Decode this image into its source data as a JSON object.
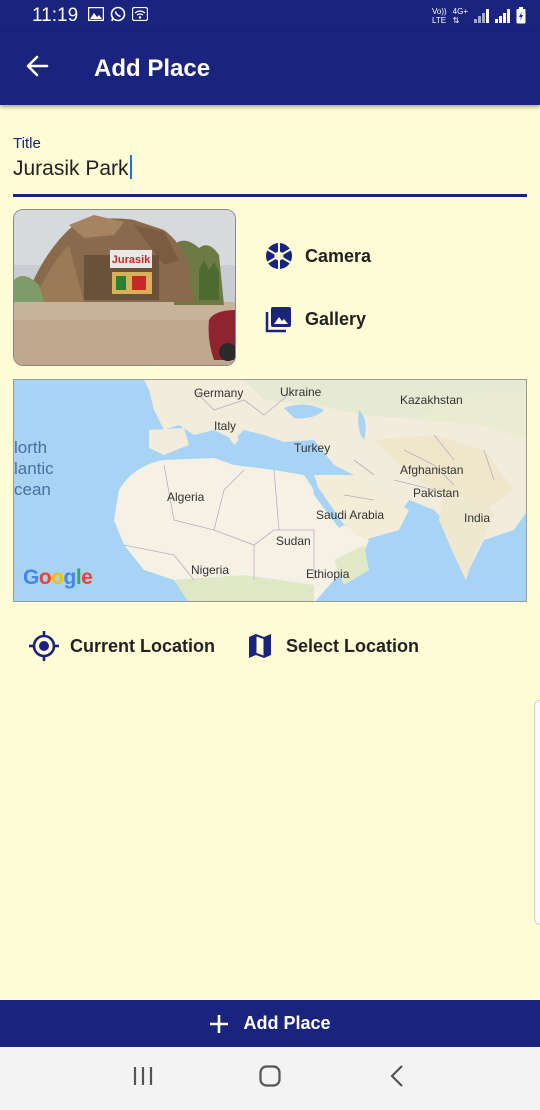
{
  "status_bar": {
    "time": "11:19",
    "volte_line1": "Vo))",
    "volte_line2": "LTE",
    "network_line1": "4G+",
    "network_line2": "⇅",
    "icons": [
      "image-icon",
      "whatsapp-icon",
      "wifi-icon",
      "signal-icon",
      "battery-icon"
    ]
  },
  "app_bar": {
    "title": "Add Place",
    "back_icon": "arrow-back-icon"
  },
  "form": {
    "title_label": "Title",
    "title_value": "Jurasik Park"
  },
  "photo": {
    "sign_text": "Jurasik"
  },
  "image_actions": {
    "camera_label": "Camera",
    "gallery_label": "Gallery"
  },
  "map": {
    "labels": {
      "germany": "Germany",
      "ukraine": "Ukraine",
      "kazakhstan": "Kazakhstan",
      "italy": "Italy",
      "turkey": "Turkey",
      "afghanistan": "Afghanistan",
      "pakistan": "Pakistan",
      "india": "India",
      "algeria": "Algeria",
      "saudi_arabia": "Saudi Arabia",
      "sudan": "Sudan",
      "nigeria": "Nigeria",
      "ethiopia": "Ethiopia"
    },
    "ocean_lines": [
      "lorth",
      "lantic",
      "cean"
    ],
    "attribution": "Google"
  },
  "location_actions": {
    "current_location_label": "Current Location",
    "select_location_label": "Select Location"
  },
  "bottom_button": {
    "label": "Add Place"
  },
  "colors": {
    "primary": "#1a237e",
    "background": "#fffdd6",
    "caret": "#1976d2"
  }
}
